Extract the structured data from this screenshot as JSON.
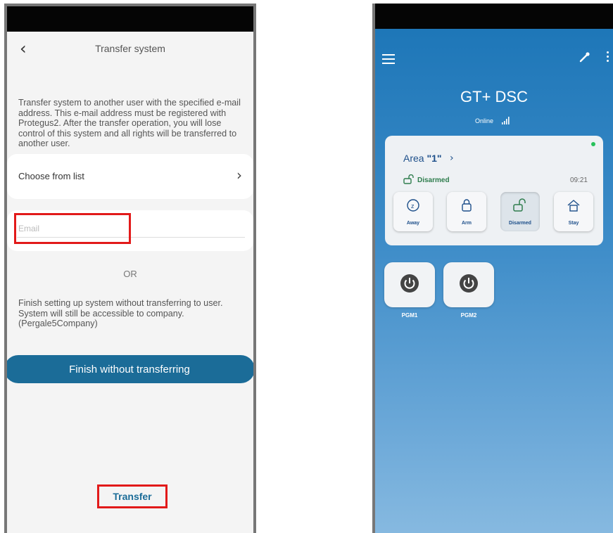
{
  "left": {
    "nav_title": "Transfer system",
    "description": "Transfer system to another user with the specified e-mail address. This e-mail address must be registered with Protegus2. After the transfer operation, you will lose control of this system and all rights will be transferred to another user.",
    "choose_from_list": "Choose from list",
    "email_placeholder": "Email",
    "or_label": "OR",
    "finish_text": "Finish setting up system without transferring to user. System will still be accessible to company. (Pergale5Company)",
    "finish_button": "Finish without transferring",
    "transfer_button": "Transfer"
  },
  "right": {
    "system_title": "GT+ DSC",
    "connection_status": "Online",
    "area": {
      "name_prefix": "Area ",
      "name": "\"1\"",
      "status": "Disarmed",
      "time": "09:21",
      "modes": [
        {
          "label": "Away",
          "icon": "away-icon"
        },
        {
          "label": "Arm",
          "icon": "lock-icon"
        },
        {
          "label": "Disarmed",
          "icon": "unlock-icon",
          "active": true
        },
        {
          "label": "Stay",
          "icon": "home-icon"
        }
      ]
    },
    "pgms": [
      {
        "label": "PGM1",
        "icon": "power-icon"
      },
      {
        "label": "PGM2",
        "icon": "power-icon"
      }
    ]
  },
  "colors": {
    "accent": "#1b6c98",
    "highlight": "#e21a1a",
    "online_dot": "#27c15b",
    "disarmed": "#2e7d4d"
  }
}
